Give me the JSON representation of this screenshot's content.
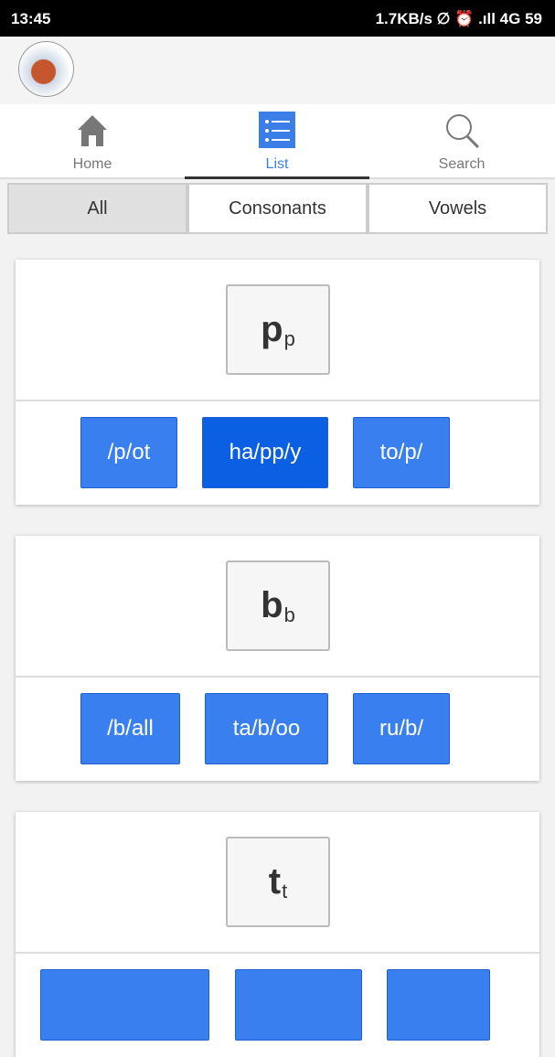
{
  "status_bar": {
    "time": "13:45",
    "right": "1.7KB/s ∅ ⏰ .ıll 4G 59",
    "battery": "59"
  },
  "nav": {
    "tabs": [
      {
        "label": "Home",
        "icon": "home-icon"
      },
      {
        "label": "List",
        "icon": "list-icon",
        "active": true
      },
      {
        "label": "Search",
        "icon": "search-icon"
      }
    ]
  },
  "filter": {
    "options": [
      "All",
      "Consonants",
      "Vowels"
    ],
    "selected": "All"
  },
  "cards": [
    {
      "letter": "p",
      "sub": "p",
      "words": [
        "/p/ot",
        "ha/pp/y",
        "to/p/"
      ],
      "active_word": 1
    },
    {
      "letter": "b",
      "sub": "b",
      "words": [
        "/b/all",
        "ta/b/oo",
        "ru/b/"
      ]
    },
    {
      "letter": "t",
      "sub": "t",
      "words": [
        "",
        "",
        ""
      ]
    }
  ],
  "colors": {
    "accent": "#3a7ff0",
    "accent_active": "#0b5fe2"
  }
}
